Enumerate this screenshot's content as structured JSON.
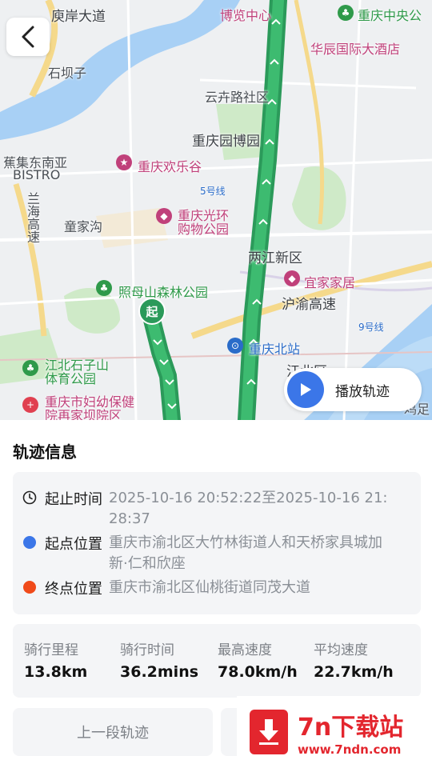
{
  "map": {
    "labels": {
      "l1": "庾岸大道",
      "l2": "重庆中央公",
      "l3": "博览中心",
      "l4": "华辰国际大酒店",
      "l5": "石坝子",
      "l6": "云卉路社区",
      "l7": "重庆园博园",
      "l8": "蕉集东南亚",
      "l9": "BISTRO",
      "l10": "重庆欢乐谷",
      "l11": "5号线",
      "l12": "重庆光环",
      "l13": "购物公园",
      "l14": "童家沟",
      "l15": "两江新区",
      "l16": "照母山森林公园",
      "l17": "宜家家居",
      "l18": "沪渝高速",
      "l19": "9号线",
      "l20": "重庆北站",
      "l21": "江北区",
      "l22": "江北石子山",
      "l23": "体育公园",
      "l24": "重庆市妇幼保健",
      "l25": "院再家坝院区",
      "l26": "兰海高速",
      "l27": "鸡足"
    },
    "start_marker": "起",
    "play_button_label": "播放轨迹"
  },
  "panel": {
    "title": "轨迹信息",
    "time_key": "起止时间",
    "time_val": "2025-10-16 20:52:22至2025-10-16 21:28:37",
    "start_key": "起点位置",
    "start_val": "重庆市渝北区大竹林街道人和天桥家具城加新·仁和欣座",
    "end_key": "终点位置",
    "end_val": "重庆市渝北区仙桃街道同茂大道",
    "stats": {
      "distance_label": "骑行里程",
      "distance_value": "13.8km",
      "duration_label": "骑行时间",
      "duration_value": "36.2mins",
      "max_speed_label": "最高速度",
      "max_speed_value": "78.0km/h",
      "avg_speed_label": "平均速度",
      "avg_speed_value": "22.7km/h"
    },
    "prev_button": "上一段轨迹"
  },
  "watermark": {
    "title": "7n下载站",
    "url": "www.7ndn.com"
  },
  "colors": {
    "route": "#2b9a5a",
    "start_dot": "#3b76e8",
    "end_dot": "#f04a1a",
    "play_button": "#3b76e8"
  }
}
